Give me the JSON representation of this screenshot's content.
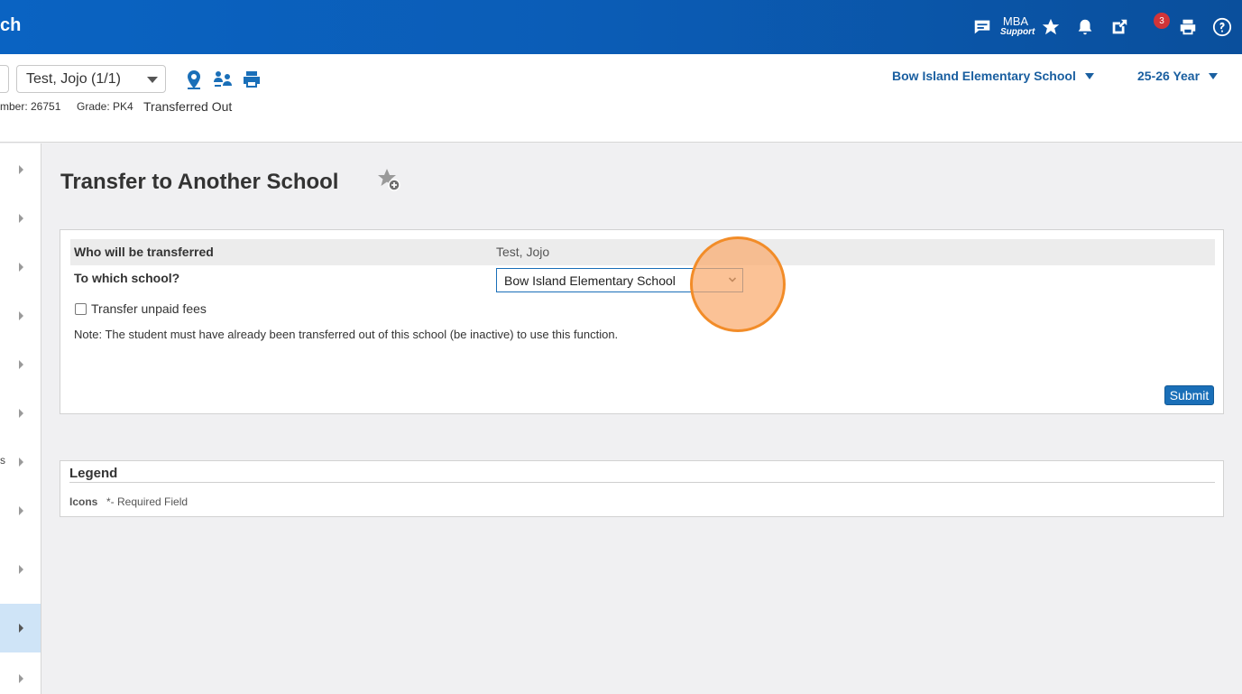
{
  "topbar": {
    "app_name": "ch",
    "mba_line1": "MBA",
    "mba_line2": "Support",
    "notification_count": "3"
  },
  "header": {
    "student_selector": "Test, Jojo  (1/1)",
    "student_number": "mber: 26751",
    "grade": "Grade: PK4",
    "status": "Transferred Out",
    "school_context": "Bow Island Elementary School",
    "year_context": "25-26 Year"
  },
  "sidebar": {
    "fragment_text": "s",
    "active_index": 9
  },
  "page": {
    "title": "Transfer to Another School"
  },
  "form": {
    "who_label": "Who will be transferred",
    "who_value": "Test, Jojo",
    "school_label": "To which school?",
    "school_selected": "Bow Island Elementary School",
    "unpaid_fees_label": "Transfer unpaid fees",
    "unpaid_fees_checked": false,
    "note": "Note: The student must have already been transferred out of this school (be inactive) to use this function.",
    "submit_label": "Submit"
  },
  "legend": {
    "title": "Legend",
    "icons_label": "Icons",
    "required_text": "*- Required Field"
  },
  "colors": {
    "topbar": "#0b5db7",
    "accent": "#1a6fb8",
    "click_highlight": "#f28c28",
    "badge": "#d13438"
  },
  "icons": [
    "chat-icon",
    "star-icon",
    "bell-icon",
    "external-link-icon",
    "print-icon",
    "help-icon",
    "map-pin-icon",
    "people-icon",
    "favorite-add-icon"
  ]
}
